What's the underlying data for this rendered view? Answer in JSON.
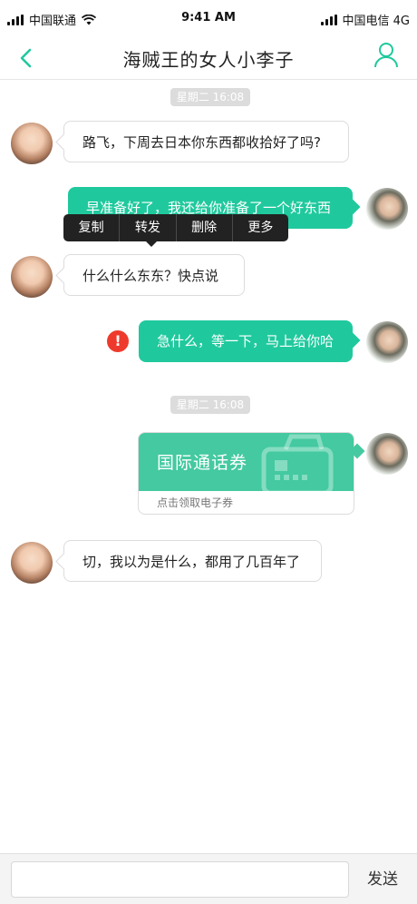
{
  "status_bar": {
    "carrier_left": "中国联通",
    "time": "9:41 AM",
    "carrier_right": "中国电信 4G"
  },
  "header": {
    "title": "海贼王的女人小李子",
    "back_icon": "chevron-left-icon",
    "profile_icon": "user-icon",
    "accent_color": "#1fc99d"
  },
  "chat": {
    "timestamps": [
      "星期二 16:08",
      "星期二 16:08"
    ],
    "messages": [
      {
        "side": "left",
        "text": "路飞，下周去日本你东西都收拾好了吗?"
      },
      {
        "side": "right",
        "text": "早准备好了，我还给你准备了一个好东西"
      },
      {
        "side": "left",
        "text": "什么什么东东？快点说"
      },
      {
        "side": "right",
        "text": "急什么，等一下，马上给你哈",
        "status": "failed"
      },
      {
        "side": "left",
        "text": "切，我以为是什么，都用了几百年了"
      }
    ],
    "context_menu": [
      "复制",
      "转发",
      "删除",
      "更多"
    ],
    "coupon": {
      "title": "国际通话券",
      "subtitle": "点击领取电子券"
    },
    "error_mark": "!"
  },
  "input_bar": {
    "placeholder": "",
    "send_label": "发送"
  }
}
